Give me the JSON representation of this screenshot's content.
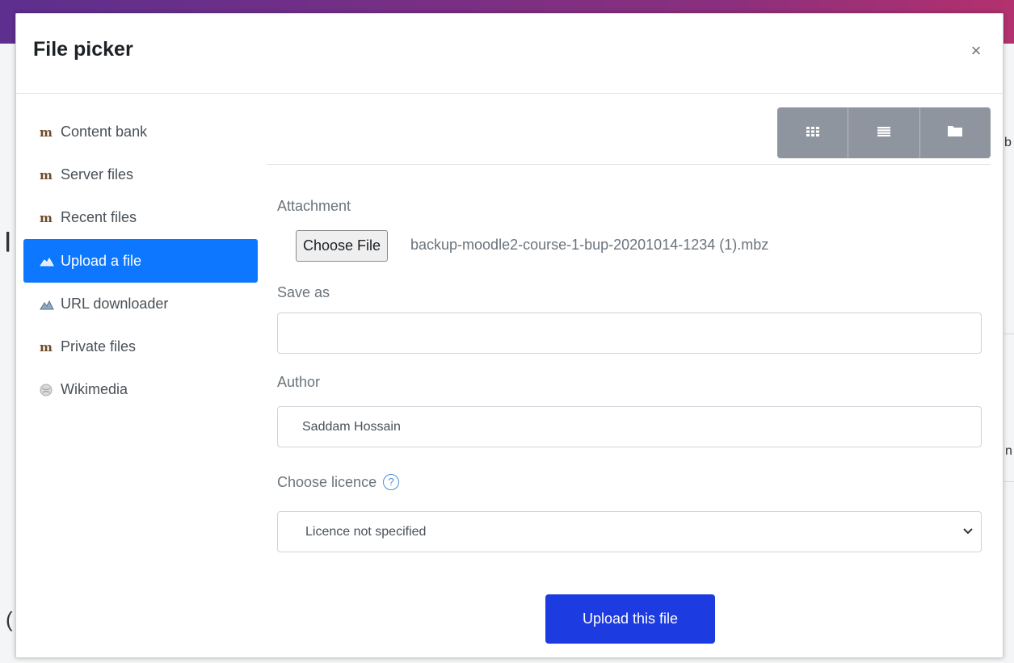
{
  "dialog": {
    "title": "File picker",
    "close_label": "×"
  },
  "sidebar": {
    "items": [
      {
        "label": "Content bank",
        "icon": "moodle-icon",
        "active": false
      },
      {
        "label": "Server files",
        "icon": "moodle-icon",
        "active": false
      },
      {
        "label": "Recent files",
        "icon": "moodle-icon",
        "active": false
      },
      {
        "label": "Upload a file",
        "icon": "upload-icon",
        "active": true
      },
      {
        "label": "URL downloader",
        "icon": "url-download-icon",
        "active": false
      },
      {
        "label": "Private files",
        "icon": "moodle-icon",
        "active": false
      },
      {
        "label": "Wikimedia",
        "icon": "wikimedia-icon",
        "active": false
      }
    ]
  },
  "toolbar": {
    "views": [
      "grid-view-icon",
      "list-view-icon",
      "folder-view-icon"
    ]
  },
  "form": {
    "attachment_label": "Attachment",
    "choose_file_label": "Choose File",
    "file_name": "backup-moodle2-course-1-bup-20201014-1234 (1).mbz",
    "save_as_label": "Save as",
    "save_as_value": "",
    "author_label": "Author",
    "author_value": "Saddam Hossain",
    "licence_label": "Choose licence",
    "licence_value": "Licence not specified",
    "upload_button": "Upload this file"
  },
  "colors": {
    "active_item": "#0d78ff",
    "upload_button": "#1c3be0",
    "view_bar": "#8f959e"
  }
}
